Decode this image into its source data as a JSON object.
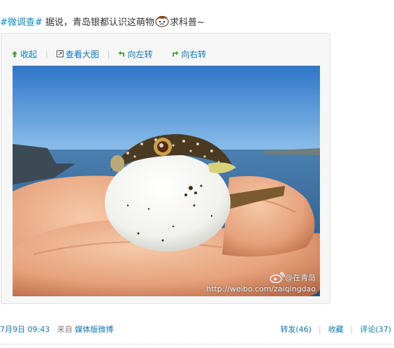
{
  "post": {
    "topic": "#微调查#",
    "text_before": " 据说，青岛银都认识这萌物",
    "emoticon": "puzzled-face-icon",
    "text_after": "求科普~"
  },
  "toolbar": {
    "collapse": "收起",
    "view_large": "查看大图",
    "rotate_left": "向左转",
    "rotate_right": "向右转"
  },
  "photo": {
    "subject": "pufferfish-on-fingers",
    "watermark_brand": "@在青岛",
    "watermark_url": "http://weibo.com/zaiqingdao"
  },
  "meta": {
    "date": "7月9日",
    "time": "09:43",
    "from_label": "来自",
    "source": "媒体版微博",
    "repost": "转发",
    "repost_count": "(46)",
    "favorite": "收藏",
    "comment": "评论",
    "comment_count": "(37)"
  },
  "colors": {
    "link": "#0a7ac2",
    "topic": "#0a8cd2",
    "muted": "#808080"
  }
}
